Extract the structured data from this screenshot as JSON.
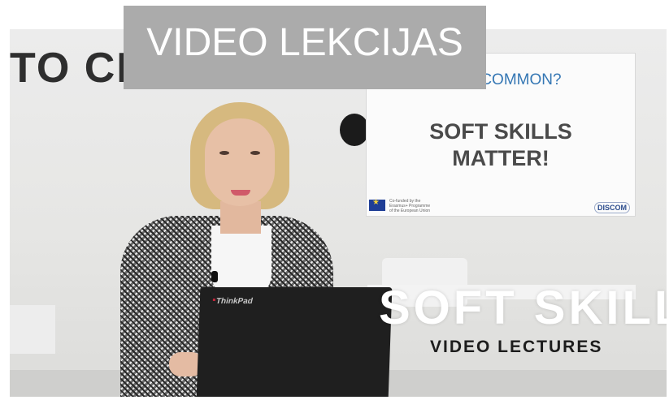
{
  "banner": {
    "title": "VIDEO LEKCIJAS"
  },
  "scene": {
    "wall_text": "TO CI",
    "slide": {
      "question": "G IN COMMON?",
      "headline": "SOFT SKILLS\nMATTER!",
      "eu_text": "Co-funded by the\nErasmus+ Programme\nof the European Union",
      "logo": "DISCOM"
    },
    "laptop_brand": "ThinkPad",
    "overlay": {
      "title": "SOFT SKILLS",
      "subtitle": "VIDEO LECTURES"
    }
  },
  "colors": {
    "banner_bg": "#ababab",
    "slide_question": "#3577b4",
    "overlay_title": "#ffffff",
    "overlay_subtitle": "#1c1c1c"
  }
}
